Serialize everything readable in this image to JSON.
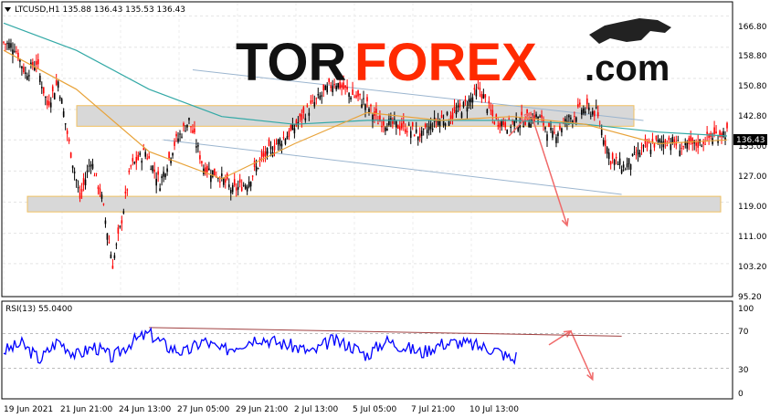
{
  "main_panel": {
    "symbol_header": "LTCUSD,H1  135.88 136.43 135.53 136.43",
    "current_price": "136.43",
    "y_ticks": [
      "166.80",
      "158.80",
      "150.80",
      "142.80",
      "135.00",
      "127.00",
      "119.00",
      "111.00",
      "103.20",
      "95.20"
    ]
  },
  "rsi_panel": {
    "header": "RSI(13) 55.0400",
    "y_ticks": [
      "100",
      "70",
      "30",
      "0"
    ]
  },
  "x_ticks": [
    "19 Jun 2021",
    "21 Jun 21:00",
    "24 Jun 13:00",
    "27 Jun 05:00",
    "29 Jun 21:00",
    "2 Jul 13:00",
    "5 Jul 05:00",
    "7 Jul 21:00",
    "10 Jul 13:00"
  ],
  "logo": {
    "part1": "TOR",
    "part2": "FOREX",
    "part3": ".com"
  },
  "colors": {
    "bull_candle": "#000000",
    "bear_candle": "#ff0000",
    "ma_fast": "#e8a33a",
    "ma_slow": "#33a9a6",
    "rsi_line": "#0000ff",
    "zone_fill": "#d8d8d8",
    "zone_border": "#f0c060",
    "channel_line": "#9bb5cf",
    "arrow": "#f06a6a"
  },
  "chart_data": {
    "type": "candlestick",
    "title": "LTCUSD,H1",
    "ylim": [
      95.2,
      170
    ],
    "price_path": [
      [
        0,
        160
      ],
      [
        3,
        159
      ],
      [
        6,
        152
      ],
      [
        9,
        155
      ],
      [
        12,
        144
      ],
      [
        15,
        150
      ],
      [
        18,
        134
      ],
      [
        21,
        120
      ],
      [
        24,
        130
      ],
      [
        27,
        120
      ],
      [
        30,
        103
      ],
      [
        32,
        112
      ],
      [
        35,
        128
      ],
      [
        39,
        132
      ],
      [
        43,
        124
      ],
      [
        47,
        134
      ],
      [
        51,
        140
      ],
      [
        55,
        128
      ],
      [
        59,
        126
      ],
      [
        63,
        122
      ],
      [
        67,
        124
      ],
      [
        71,
        130
      ],
      [
        75,
        134
      ],
      [
        79,
        137
      ],
      [
        83,
        142
      ],
      [
        87,
        146
      ],
      [
        91,
        150
      ],
      [
        95,
        147
      ],
      [
        99,
        145
      ],
      [
        103,
        140
      ],
      [
        107,
        139
      ],
      [
        111,
        138
      ],
      [
        115,
        136
      ],
      [
        119,
        140
      ],
      [
        123,
        141
      ],
      [
        127,
        144
      ],
      [
        131,
        148
      ],
      [
        135,
        140
      ],
      [
        139,
        139
      ],
      [
        143,
        140
      ],
      [
        147,
        141
      ],
      [
        151,
        136
      ],
      [
        155,
        140
      ],
      [
        159,
        143
      ],
      [
        163,
        142
      ],
      [
        167,
        130
      ],
      [
        171,
        128
      ],
      [
        175,
        132
      ],
      [
        179,
        134
      ],
      [
        183,
        135
      ],
      [
        187,
        133
      ],
      [
        191,
        134
      ],
      [
        195,
        136
      ],
      [
        199,
        137
      ]
    ],
    "ma_fast": [
      [
        0,
        158
      ],
      [
        20,
        148
      ],
      [
        40,
        132
      ],
      [
        60,
        125
      ],
      [
        80,
        134
      ],
      [
        100,
        142
      ],
      [
        120,
        140
      ],
      [
        140,
        141
      ],
      [
        160,
        139
      ],
      [
        180,
        134
      ],
      [
        199,
        135
      ]
    ],
    "ma_slow": [
      [
        0,
        165
      ],
      [
        20,
        158
      ],
      [
        40,
        148
      ],
      [
        60,
        141
      ],
      [
        80,
        139
      ],
      [
        100,
        140
      ],
      [
        120,
        140
      ],
      [
        140,
        140
      ],
      [
        160,
        139
      ],
      [
        180,
        137
      ],
      [
        199,
        136
      ]
    ],
    "zones": [
      [
        138.5,
        143.8
      ],
      [
        116.5,
        120.5
      ]
    ],
    "channel_upper": [
      [
        52,
        153
      ],
      [
        176,
        140
      ]
    ],
    "channel_lower": [
      [
        44,
        135
      ],
      [
        170,
        121
      ]
    ],
    "forecast_arrow_up": [
      [
        139,
        136
      ],
      [
        145,
        142
      ]
    ],
    "forecast_arrow_down": [
      [
        145,
        142
      ],
      [
        155,
        113
      ]
    ],
    "rsi": {
      "ylim": [
        0,
        100
      ],
      "levels": [
        70,
        30
      ],
      "path": [
        [
          0,
          50
        ],
        [
          5,
          58
        ],
        [
          10,
          40
        ],
        [
          15,
          62
        ],
        [
          20,
          45
        ],
        [
          25,
          55
        ],
        [
          30,
          42
        ],
        [
          35,
          60
        ],
        [
          40,
          70
        ],
        [
          45,
          55
        ],
        [
          50,
          48
        ],
        [
          55,
          62
        ],
        [
          60,
          50
        ],
        [
          65,
          58
        ],
        [
          70,
          66
        ],
        [
          75,
          60
        ],
        [
          80,
          55
        ],
        [
          85,
          48
        ],
        [
          90,
          62
        ],
        [
          95,
          57
        ],
        [
          100,
          45
        ],
        [
          105,
          62
        ],
        [
          110,
          55
        ],
        [
          115,
          48
        ],
        [
          120,
          58
        ],
        [
          125,
          60
        ],
        [
          130,
          56
        ],
        [
          135,
          52
        ],
        [
          140,
          40
        ],
        [
          145,
          60
        ],
        [
          150,
          58
        ],
        [
          155,
          45
        ],
        [
          160,
          55
        ],
        [
          165,
          60
        ],
        [
          170,
          30
        ],
        [
          175,
          46
        ],
        [
          180,
          55
        ],
        [
          185,
          48
        ],
        [
          190,
          60
        ],
        [
          195,
          62
        ],
        [
          199,
          55
        ]
      ],
      "trend_line": [
        [
          40,
          77
        ],
        [
          170,
          67
        ]
      ],
      "arrow_up": [
        [
          150,
          57
        ],
        [
          156,
          73
        ]
      ],
      "arrow_down": [
        [
          156,
          73
        ],
        [
          162,
          17
        ]
      ]
    }
  }
}
